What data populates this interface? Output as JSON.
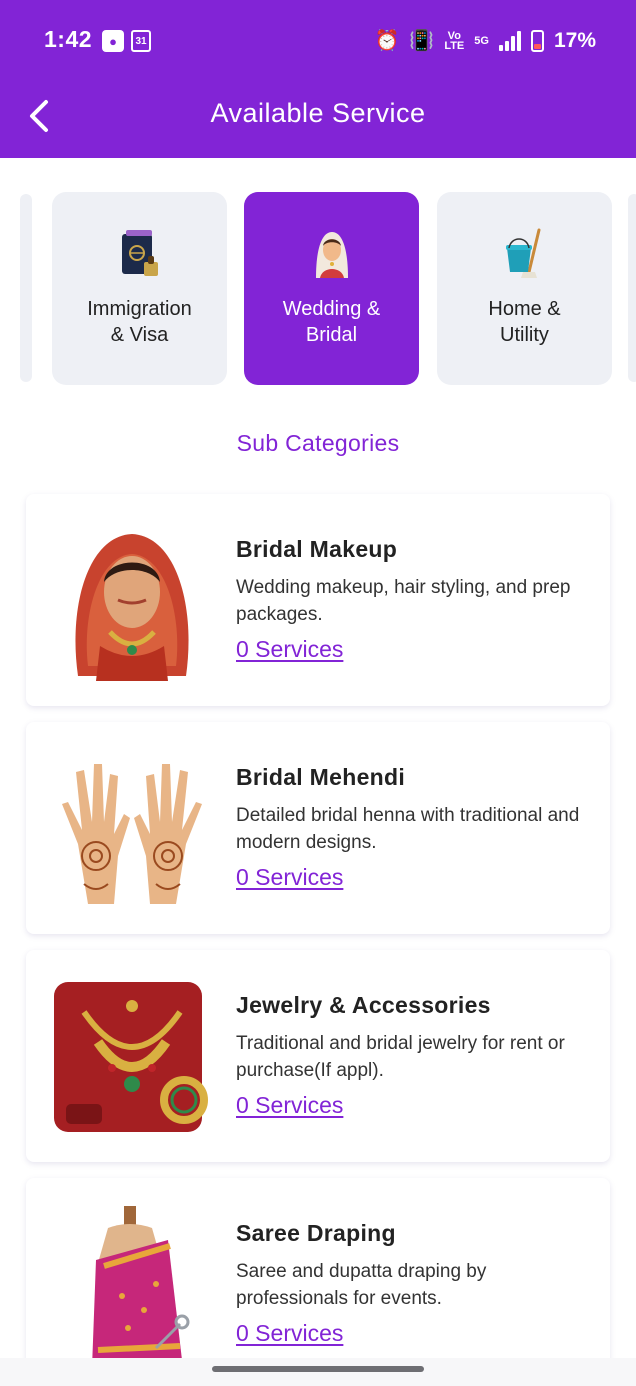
{
  "status_bar": {
    "time": "1:42",
    "calendar_day": "31",
    "battery": "17%",
    "volte_top": "Vo",
    "volte_bottom": "LTE",
    "network": "5G"
  },
  "header": {
    "title": "Available Service",
    "background_color": "#8224d6"
  },
  "categories": [
    {
      "label": "Immigration\n& Visa",
      "icon": "passport-icon",
      "active": false
    },
    {
      "label": "Wedding &\nBridal",
      "icon": "bride-icon",
      "active": true
    },
    {
      "label": "Home &\nUtility",
      "icon": "mop-bucket-icon",
      "active": false
    }
  ],
  "subcategories_title": "Sub Categories",
  "subcategories": [
    {
      "name": "Bridal Makeup",
      "description": "Wedding makeup, hair styling, and prep packages.",
      "services_link": "0 Services",
      "image": "bride-portrait-image"
    },
    {
      "name": "Bridal Mehendi",
      "description": "Detailed bridal henna with traditional and modern designs.",
      "services_link": "0 Services",
      "image": "henna-hands-image"
    },
    {
      "name": "Jewelry & Accessories",
      "description": "Traditional and bridal jewelry for rent or purchase(If appl).",
      "services_link": "0 Services",
      "image": "jewelry-set-image"
    },
    {
      "name": "Saree Draping",
      "description": "Saree and dupatta draping by professionals for events.",
      "services_link": "0 Services",
      "image": "saree-mannequin-image"
    }
  ],
  "colors": {
    "accent": "#8224d6",
    "tile_bg": "#eef0f5"
  }
}
